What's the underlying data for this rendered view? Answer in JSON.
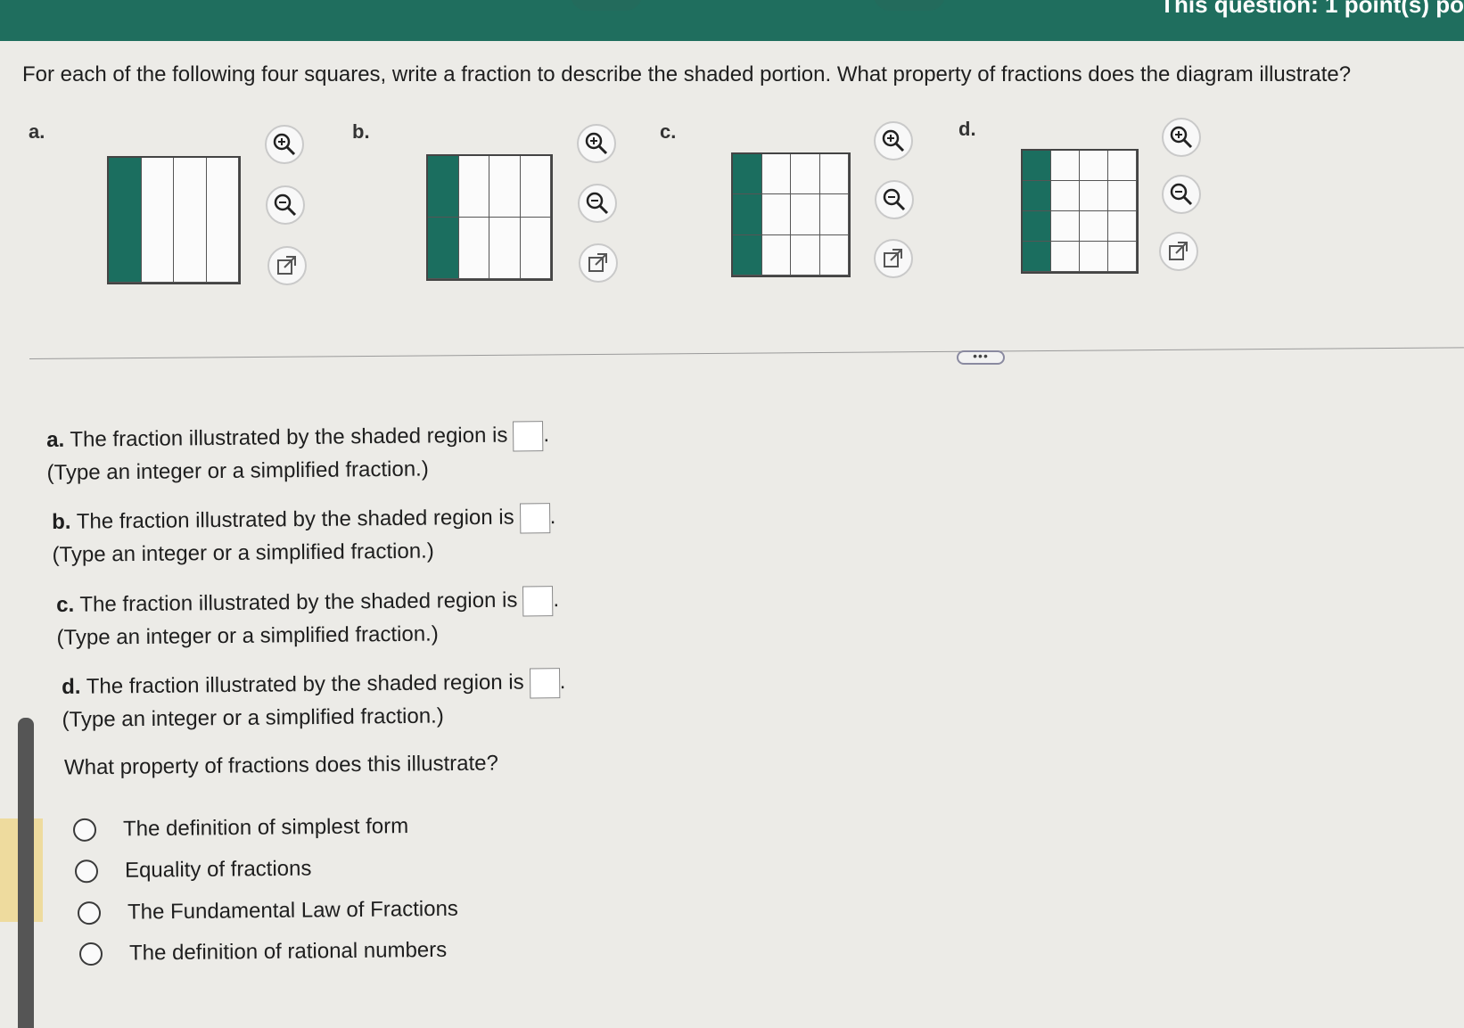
{
  "header": {
    "points_text": "This question: 1 point(s) po"
  },
  "question": {
    "prompt": "For each of the following four squares, write a fraction to describe the shaded portion. What property of fractions does the diagram illustrate?"
  },
  "figures": [
    {
      "letter": "a.",
      "rows": 1,
      "cols": 4,
      "shaded_cols": 1
    },
    {
      "letter": "b.",
      "rows": 2,
      "cols": 4,
      "shaded_cols": 1
    },
    {
      "letter": "c.",
      "rows": 3,
      "cols": 4,
      "shaded_cols": 1
    },
    {
      "letter": "d.",
      "rows": 4,
      "cols": 4,
      "shaded_cols": 1
    }
  ],
  "icons": {
    "zoom_in": "zoom-in-icon",
    "zoom_out": "zoom-out-icon",
    "popout": "external-link-icon"
  },
  "parts": [
    {
      "letter": "a.",
      "text": "The fraction illustrated by the shaded region is",
      "hint": "(Type an integer or a simplified fraction.)",
      "answer": ""
    },
    {
      "letter": "b.",
      "text": "The fraction illustrated by the shaded region is",
      "hint": "(Type an integer or a simplified fraction.)",
      "answer": ""
    },
    {
      "letter": "c.",
      "text": "The fraction illustrated by the shaded region is",
      "hint": "(Type an integer or a simplified fraction.)",
      "answer": ""
    },
    {
      "letter": "d.",
      "text": "The fraction illustrated by the shaded region is",
      "hint": "(Type an integer or a simplified fraction.)",
      "answer": ""
    }
  ],
  "property_question": "What property of fractions does this illustrate?",
  "options": [
    {
      "label": "The definition of simplest form",
      "selected": false
    },
    {
      "label": "Equality of fractions",
      "selected": false
    },
    {
      "label": "The Fundamental Law of Fractions",
      "selected": false
    },
    {
      "label": "The definition of rational numbers",
      "selected": false
    }
  ],
  "more_button_label": "•••",
  "colors": {
    "header": "#1f6e5e",
    "shaded": "#1b6e5f",
    "background": "#ecebe7"
  }
}
